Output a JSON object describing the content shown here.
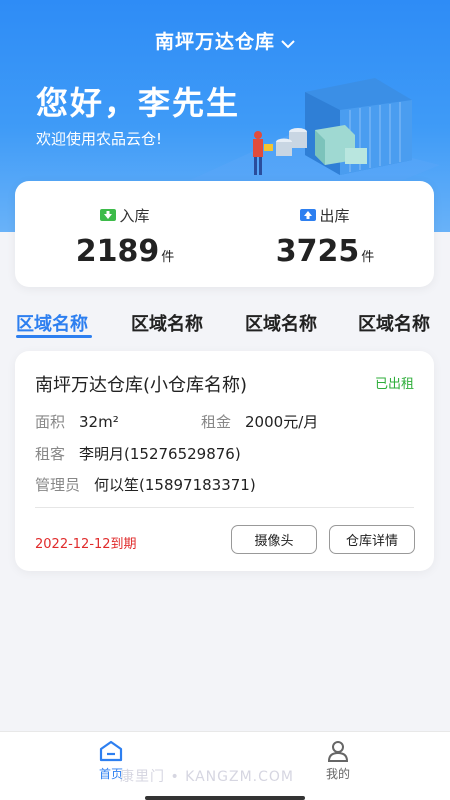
{
  "header": {
    "warehouse_name": "南坪万达仓库",
    "greeting": "您好，李先生",
    "welcome": "欢迎使用农品云仓!"
  },
  "stats": {
    "inbound": {
      "label": "入库",
      "count": "2189",
      "unit": "件"
    },
    "outbound": {
      "label": "出库",
      "count": "3725",
      "unit": "件"
    }
  },
  "tabs": [
    "区域名称",
    "区域名称",
    "区域名称",
    "区域名称"
  ],
  "card": {
    "title": "南坪万达仓库(小仓库名称)",
    "status": "已出租",
    "area_label": "面积",
    "area_value": "32m²",
    "rent_label": "租金",
    "rent_value": "2000元/月",
    "tenant_label": "租客",
    "tenant_value": "李明月(15276529876)",
    "manager_label": "管理员",
    "manager_value": "何以笙(15897183371)",
    "expire": "2022-12-12到期",
    "camera_button": "摄像头",
    "detail_button": "仓库详情"
  },
  "tabbar": {
    "home": "首页",
    "mine": "我的"
  },
  "watermark": "康里门 • KANGZM.COM",
  "colors": {
    "primary": "#2d7ff0",
    "status_green": "#2eae3a",
    "expire_red": "#e02b2b"
  }
}
